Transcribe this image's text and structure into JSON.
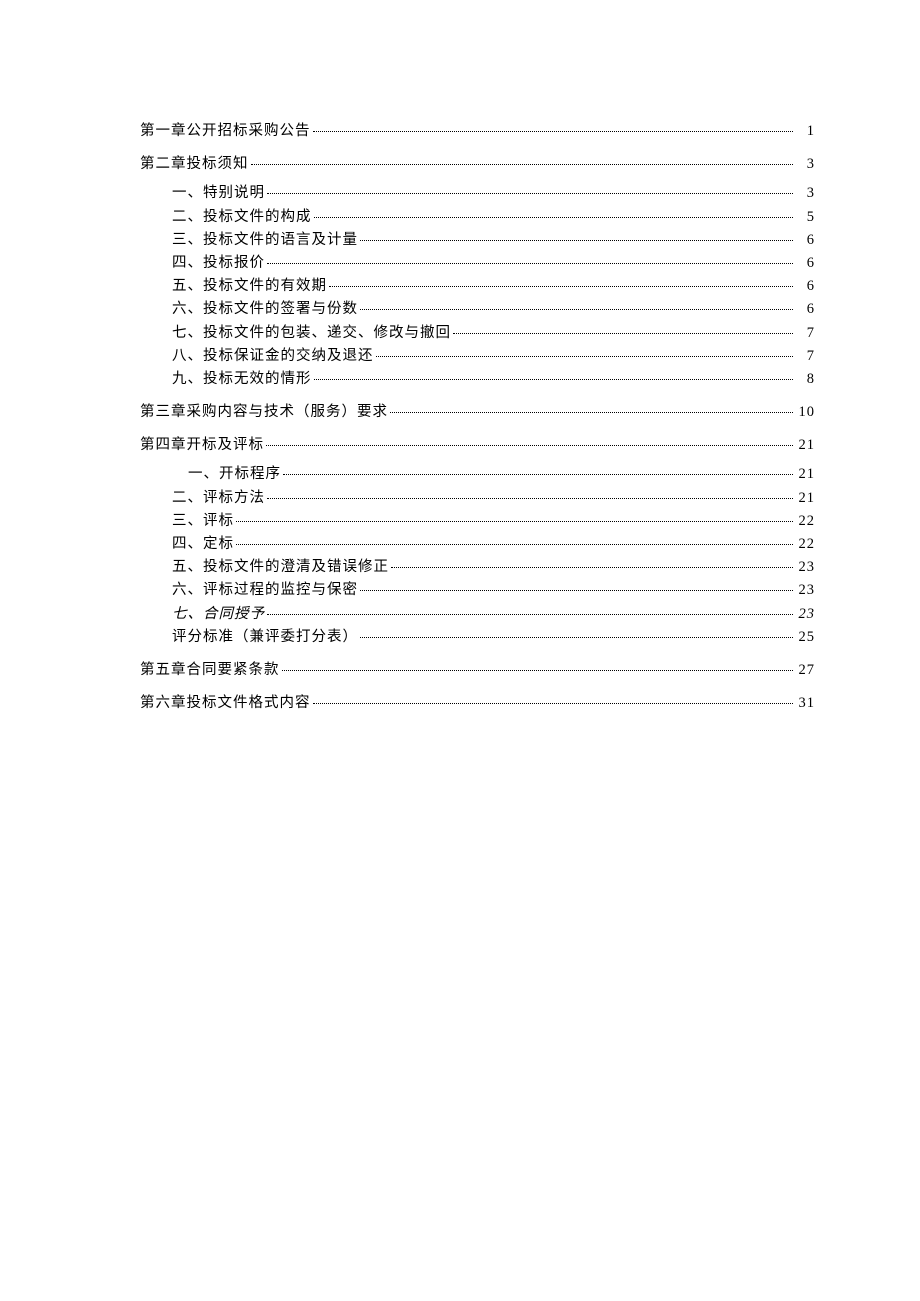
{
  "toc": [
    {
      "label": "第一章公开招标采购公告",
      "page": "1",
      "level": "chapter"
    },
    {
      "label": "第二章投标须知",
      "page": "3",
      "level": "chapter"
    },
    {
      "label": "一、特别说明",
      "page": "3",
      "level": "sub"
    },
    {
      "label": "二、投标文件的构成",
      "page": "5",
      "level": "sub"
    },
    {
      "label": "三、投标文件的语言及计量",
      "page": "6",
      "level": "sub"
    },
    {
      "label": "四、投标报价",
      "page": "6",
      "level": "sub"
    },
    {
      "label": "五、投标文件的有效期",
      "page": "6",
      "level": "sub"
    },
    {
      "label": "六、投标文件的签署与份数",
      "page": "6",
      "level": "sub"
    },
    {
      "label": "七、投标文件的包装、递交、修改与撤回",
      "page": "7",
      "level": "sub"
    },
    {
      "label": "八、投标保证金的交纳及退还",
      "page": "7",
      "level": "sub"
    },
    {
      "label": "九、投标无效的情形",
      "page": "8",
      "level": "sub"
    },
    {
      "label": "第三章采购内容与技术（服务）要求",
      "page": "10",
      "level": "chapter-nogap"
    },
    {
      "label": "第四章开标及评标",
      "page": "21",
      "level": "chapter"
    },
    {
      "label": "一、开标程序",
      "page": "21",
      "level": "sub-extra"
    },
    {
      "label": "二、评标方法",
      "page": "21",
      "level": "sub"
    },
    {
      "label": "三、评标",
      "page": "22",
      "level": "sub"
    },
    {
      "label": "四、定标",
      "page": "22",
      "level": "sub"
    },
    {
      "label": "五、投标文件的澄清及错误修正",
      "page": "23",
      "level": "sub"
    },
    {
      "label": "六、评标过程的监控与保密",
      "page": "23",
      "level": "sub"
    },
    {
      "label": "七、合同授予",
      "page": "23",
      "level": "sub",
      "italic": true
    },
    {
      "label": "评分标准（兼评委打分表）",
      "page": "25",
      "level": "sub"
    },
    {
      "label": "第五章合同要紧条款",
      "page": "27",
      "level": "chapter-nogap"
    },
    {
      "label": "第六章投标文件格式内容",
      "page": "31",
      "level": "chapter"
    }
  ]
}
